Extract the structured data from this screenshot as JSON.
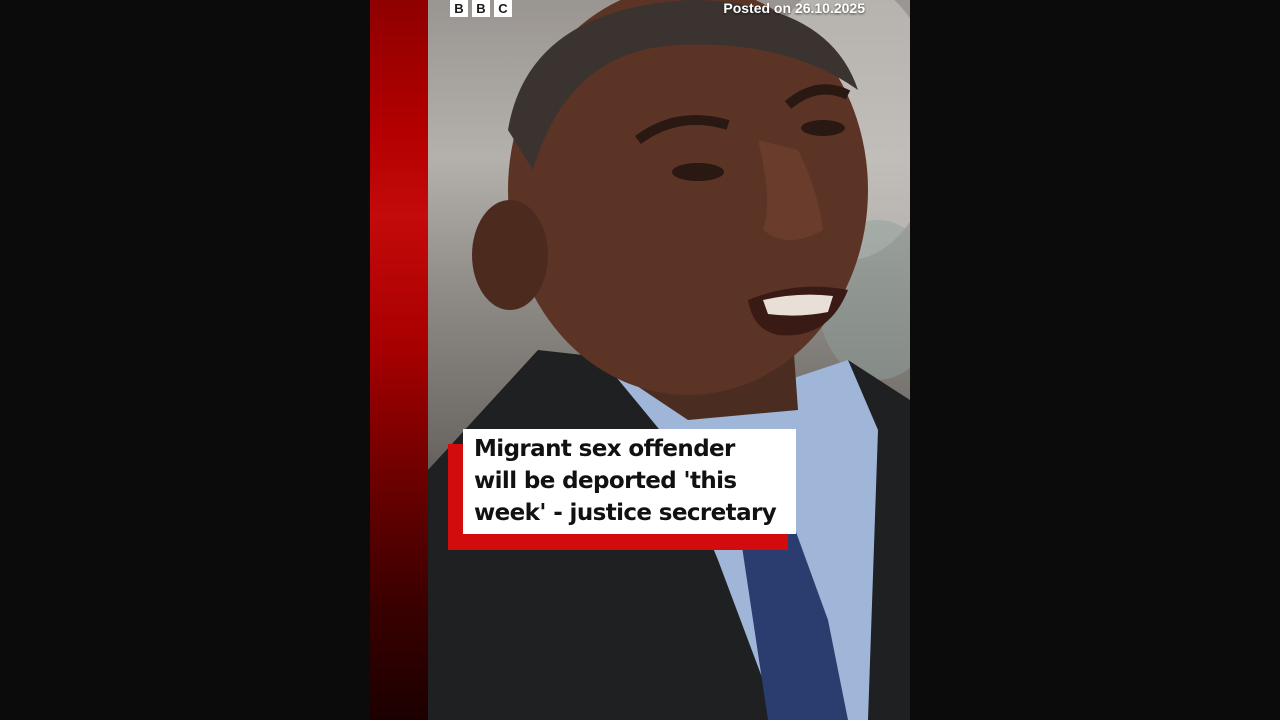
{
  "overlay": {
    "logo_letters": [
      "B",
      "B",
      "C"
    ],
    "posted_text": "Posted on 26.10.2025",
    "headline": "Migrant sex offender\nwill be deported 'this\nweek' - justice secretary"
  },
  "colors": {
    "bbc_red": "#d20c0c",
    "background": "#0b0b0b"
  }
}
